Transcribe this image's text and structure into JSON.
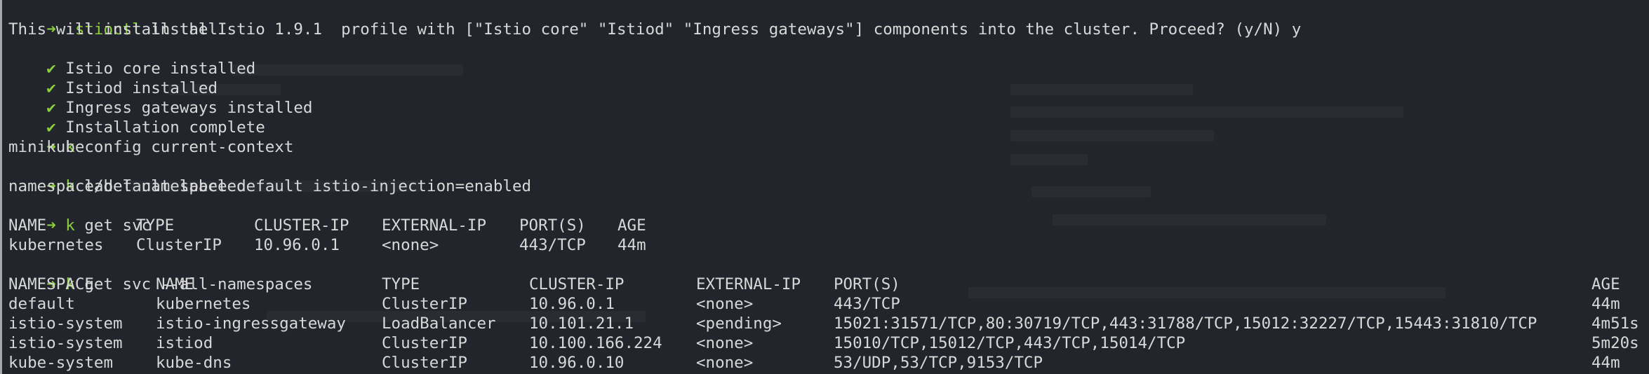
{
  "theme": {
    "background": "#23252c",
    "foreground": "#d8d8d8",
    "prompt_color": "#8ccf3c"
  },
  "prompt_symbol": "➜",
  "lines": {
    "l0": {
      "cmd": "istioctl",
      "args": " install"
    },
    "l1": "This will install the Istio 1.9.1  profile with [\"Istio core\" \"Istiod\" \"Ingress gateways\"] components into the cluster. Proceed? (y/N) y",
    "l2": {
      "mark": "✔",
      "text": " Istio core installed"
    },
    "l3": {
      "mark": "✔",
      "text": " Istiod installed"
    },
    "l4": {
      "mark": "✔",
      "text": " Ingress gateways installed"
    },
    "l5": {
      "mark": "✔",
      "text": " Installation complete"
    },
    "l6": {
      "cmd": "k",
      "args": " config current-context"
    },
    "l7": "minikube",
    "l8": {
      "cmd": "k",
      "args": " label namespace default istio-injection=enabled"
    },
    "l9": "namespace/default labeled",
    "l10": {
      "cmd": "k",
      "args": " get svc"
    },
    "l13": {
      "cmd": "k",
      "args": " get svc --all-namespaces"
    }
  },
  "svc_table": {
    "headers": [
      "NAME",
      "TYPE",
      "CLUSTER-IP",
      "EXTERNAL-IP",
      "PORT(S)",
      "AGE"
    ],
    "rows": [
      [
        "kubernetes",
        "ClusterIP",
        "10.96.0.1",
        "<none>",
        "443/TCP",
        "44m"
      ]
    ]
  },
  "all_svc_table": {
    "headers": [
      "NAMESPACE",
      "NAME",
      "TYPE",
      "CLUSTER-IP",
      "EXTERNAL-IP",
      "PORT(S)",
      "AGE"
    ],
    "rows": [
      [
        "default",
        "kubernetes",
        "ClusterIP",
        "10.96.0.1",
        "<none>",
        "443/TCP",
        "44m"
      ],
      [
        "istio-system",
        "istio-ingressgateway",
        "LoadBalancer",
        "10.101.21.1",
        "<pending>",
        "15021:31571/TCP,80:30719/TCP,443:31788/TCP,15012:32227/TCP,15443:31810/TCP",
        "4m51s"
      ],
      [
        "istio-system",
        "istiod",
        "ClusterIP",
        "10.100.166.224",
        "<none>",
        "15010/TCP,15012/TCP,443/TCP,15014/TCP",
        "5m20s"
      ],
      [
        "kube-system",
        "kube-dns",
        "ClusterIP",
        "10.96.0.10",
        "<none>",
        "53/UDP,53/TCP,9153/TCP",
        "44m"
      ]
    ]
  }
}
